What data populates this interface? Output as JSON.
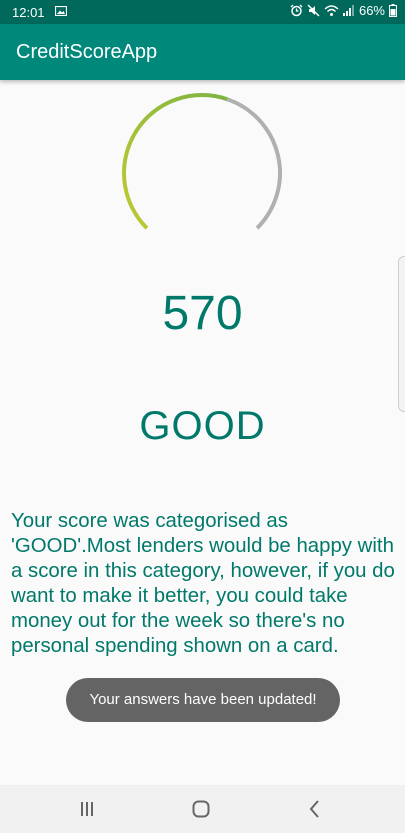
{
  "status_bar": {
    "time": "12:01",
    "battery": "66%",
    "icons": [
      "image-icon",
      "alarm-icon",
      "mute-icon",
      "wifi-icon",
      "signal-icon",
      "battery-icon"
    ]
  },
  "app_bar": {
    "title": "CreditScoreApp",
    "color": "#00897b"
  },
  "gauge": {
    "level": 0.57,
    "colors": {
      "start": "#c0ca33",
      "end": "#7cb342",
      "track": "#b0b0b0"
    }
  },
  "score": {
    "value": "570",
    "category": "GOOD",
    "color": "#00796b"
  },
  "description": "Your score was categorised as 'GOOD'.Most lenders would be happy with a score in this category, however, if you do want to make it better, you could take money out for the week so there's no personal spending shown on a card.",
  "toast": {
    "message": "Your answers have been updated!"
  },
  "nav_bar": {
    "buttons": [
      "recent-apps-icon",
      "home-icon",
      "back-icon"
    ]
  }
}
